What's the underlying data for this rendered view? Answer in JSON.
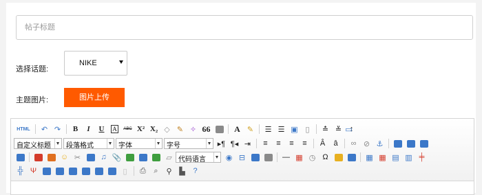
{
  "form": {
    "title_placeholder": "帖子标题",
    "topic_label": "选择话题:",
    "topic_value": "NIKE",
    "image_label": "主题图片:",
    "upload_button": "图片上传"
  },
  "editor": {
    "row1": {
      "html": "HTML",
      "bold": "B",
      "italic": "I",
      "underline": "U",
      "abc": "ABC",
      "superscript": "X²",
      "subscript": "X₂",
      "quote": "66",
      "font_color": "A"
    },
    "row2": {
      "custom_heading": "自定义标题",
      "paragraph_format": "段落格式",
      "font_family": "字体",
      "font_size": "字号",
      "code_language": "代码语言"
    },
    "colors": {
      "accent": "#ff5a00",
      "icon_blue": "#3c78c8",
      "icon_red": "#d43c2c",
      "icon_green": "#3f9e3f",
      "icon_yellow": "#e8b020"
    }
  }
}
